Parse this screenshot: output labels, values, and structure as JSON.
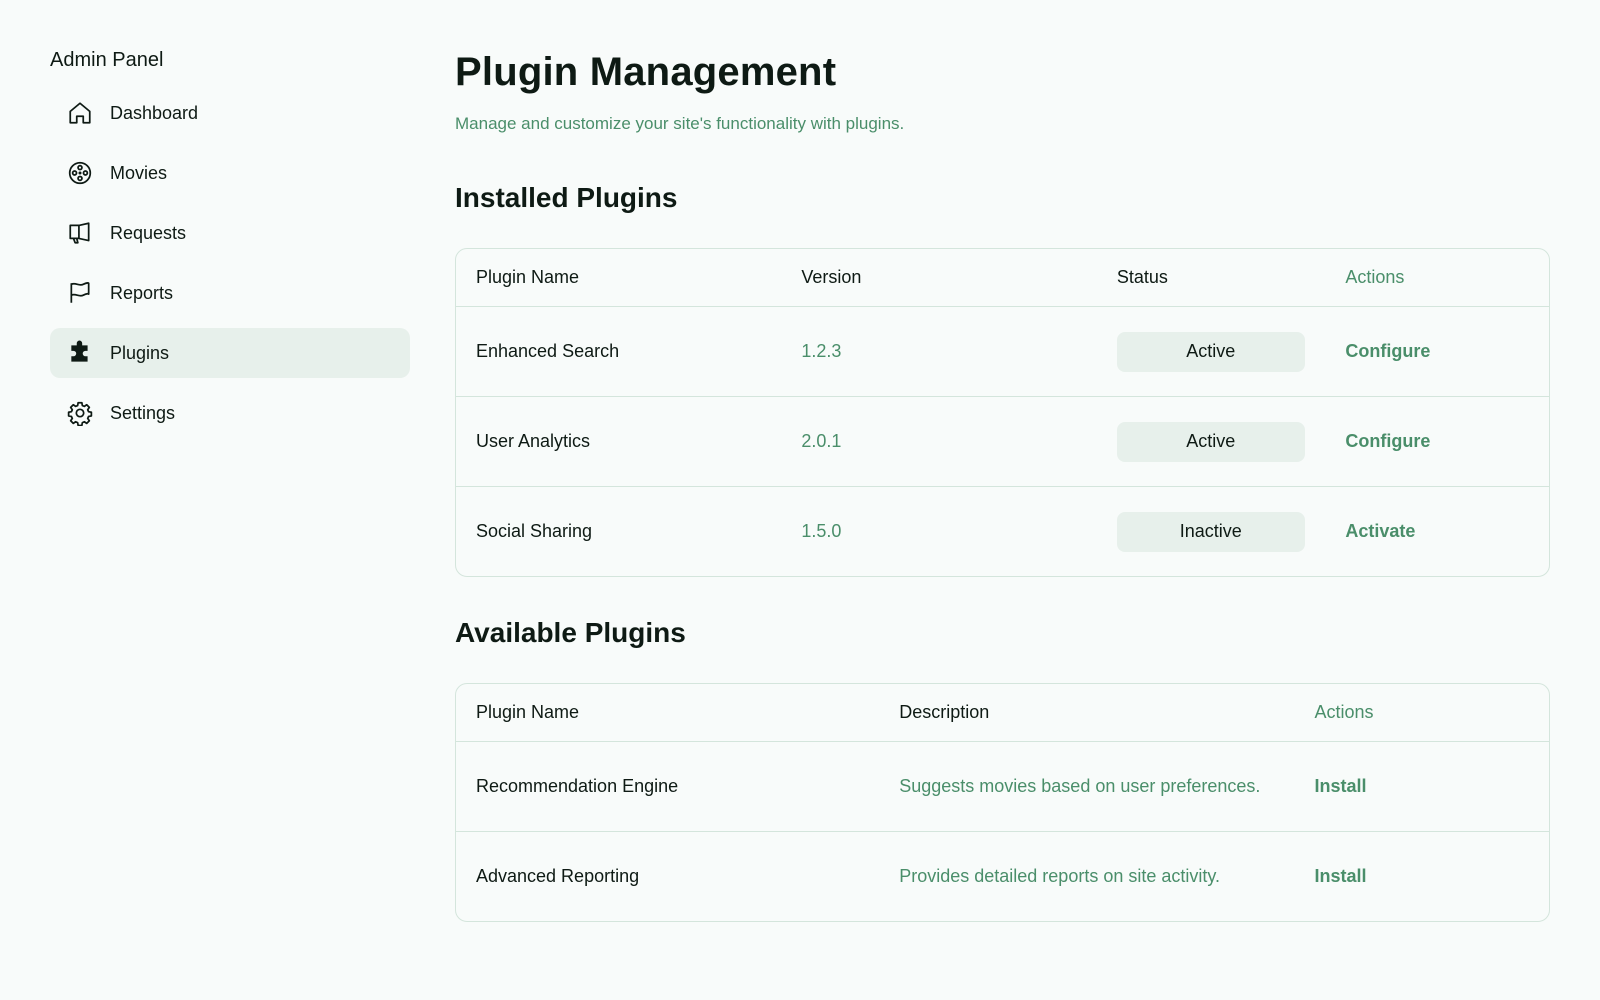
{
  "sidebar": {
    "title": "Admin Panel",
    "items": [
      {
        "label": "Dashboard",
        "icon": "home-icon"
      },
      {
        "label": "Movies",
        "icon": "film-reel-icon"
      },
      {
        "label": "Requests",
        "icon": "megaphone-icon"
      },
      {
        "label": "Reports",
        "icon": "flag-icon"
      },
      {
        "label": "Plugins",
        "icon": "puzzle-icon",
        "active": true
      },
      {
        "label": "Settings",
        "icon": "gear-icon"
      }
    ]
  },
  "main": {
    "title": "Plugin Management",
    "subtitle": "Manage and customize your site's functionality with plugins.",
    "installed": {
      "heading": "Installed Plugins",
      "columns": [
        "Plugin Name",
        "Version",
        "Status",
        "Actions"
      ],
      "rows": [
        {
          "name": "Enhanced Search",
          "version": "1.2.3",
          "status": "Active",
          "action": "Configure"
        },
        {
          "name": "User Analytics",
          "version": "2.0.1",
          "status": "Active",
          "action": "Configure"
        },
        {
          "name": "Social Sharing",
          "version": "1.5.0",
          "status": "Inactive",
          "action": "Activate"
        }
      ]
    },
    "available": {
      "heading": "Available Plugins",
      "columns": [
        "Plugin Name",
        "Description",
        "Actions"
      ],
      "rows": [
        {
          "name": "Recommendation Engine",
          "description": "Suggests movies based on user preferences.",
          "action": "Install"
        },
        {
          "name": "Advanced Reporting",
          "description": "Provides detailed reports on site activity.",
          "action": "Install"
        }
      ]
    }
  },
  "colors": {
    "accent": "#4a8e6a",
    "active_bg": "#e7f0eb",
    "border": "#d4e5dc",
    "background": "#f8fbfa",
    "text": "#0e1a14"
  }
}
